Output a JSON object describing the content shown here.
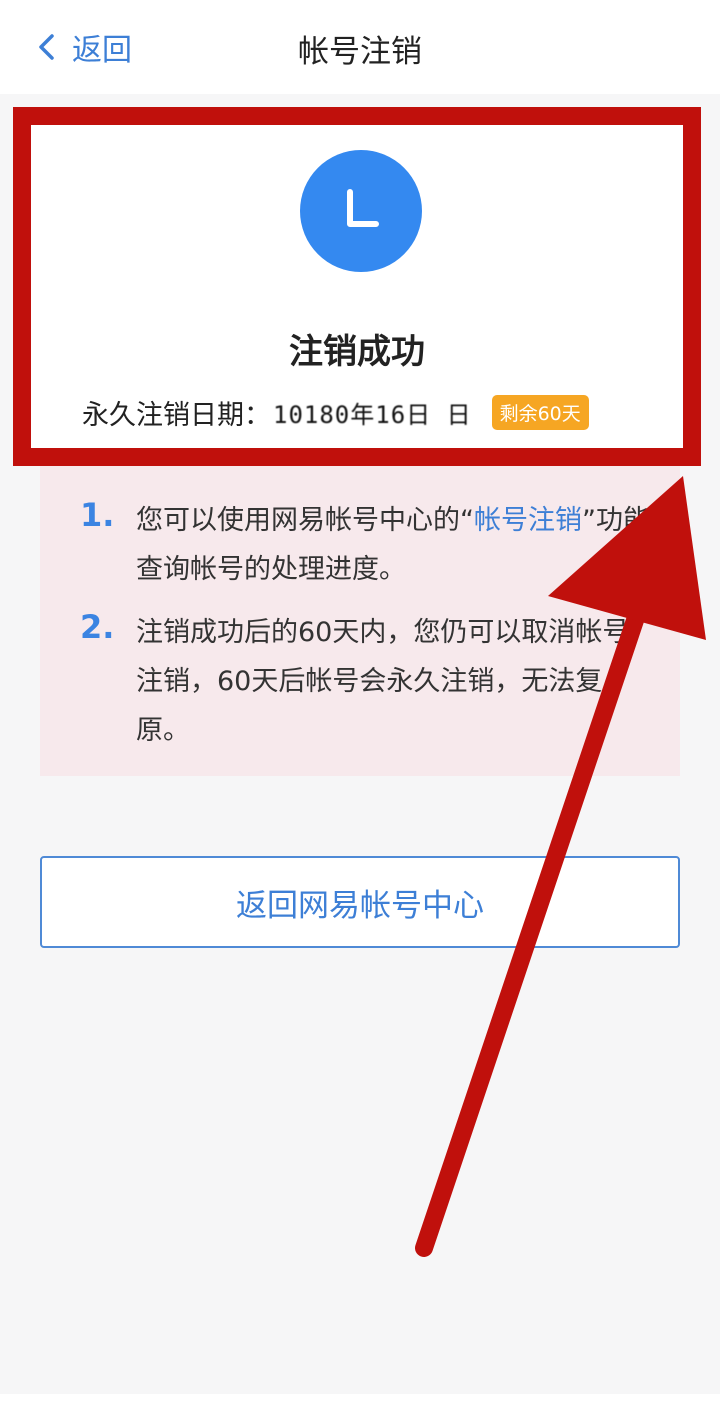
{
  "nav": {
    "back_label": "返回",
    "title": "帐号注销"
  },
  "status": {
    "avatar_letter_icon": "clock-icon",
    "title": "注销成功",
    "date_label": "永久注销日期：",
    "date_value": "10180年16日 日",
    "remaining_badge": "剩余60天"
  },
  "info": {
    "items": [
      {
        "number": "1.",
        "text_before": "您可以使用网易帐号中心的“",
        "link": "帐号注销",
        "text_after": "”功能查询帐号的处理进度。"
      },
      {
        "number": "2.",
        "text": "注销成功后的60天内，您仍可以取消帐号注销，60天后帐号会永久注销，无法复原。"
      }
    ]
  },
  "actions": {
    "return_label": "返回网易帐号中心"
  },
  "colors": {
    "accent": "#3d7fd6",
    "avatar": "#3489f0",
    "badge": "#f6a623",
    "annotation_red": "#c0100c"
  }
}
